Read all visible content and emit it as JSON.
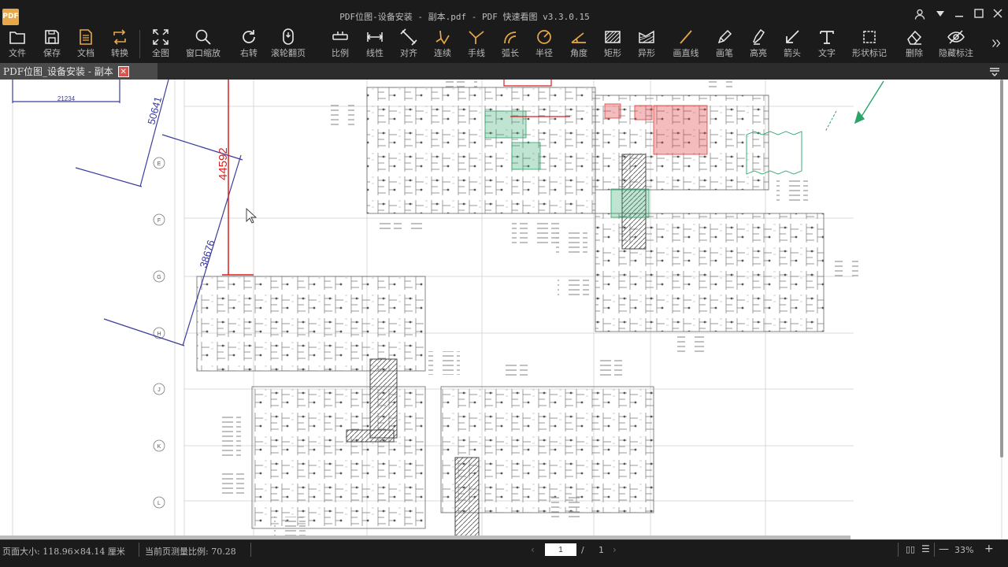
{
  "window": {
    "app_icon_text": "PDF",
    "title": "PDF位图-设备安装 - 副本.pdf - PDF 快速看图 v3.3.0.15"
  },
  "toolbar": [
    {
      "name": "file",
      "label": "文件"
    },
    {
      "name": "save",
      "label": "保存"
    },
    {
      "name": "document",
      "label": "文档"
    },
    {
      "name": "convert",
      "label": "转换"
    },
    {
      "name": "fit-all",
      "label": "全图"
    },
    {
      "name": "window-zoom",
      "label": "窗口缩放"
    },
    {
      "name": "rotate-right",
      "label": "右转"
    },
    {
      "name": "scroll-page",
      "label": "滚轮翻页"
    },
    {
      "name": "scale",
      "label": "比例"
    },
    {
      "name": "linear",
      "label": "线性"
    },
    {
      "name": "aligned",
      "label": "对齐"
    },
    {
      "name": "continuous",
      "label": "连续"
    },
    {
      "name": "hand-line",
      "label": "手线"
    },
    {
      "name": "arc-length",
      "label": "弧长"
    },
    {
      "name": "radius",
      "label": "半径"
    },
    {
      "name": "angle",
      "label": "角度"
    },
    {
      "name": "rectangle",
      "label": "矩形"
    },
    {
      "name": "irregular",
      "label": "异形"
    },
    {
      "name": "draw-line",
      "label": "画直线"
    },
    {
      "name": "pen",
      "label": "画笔"
    },
    {
      "name": "highlighter",
      "label": "高亮"
    },
    {
      "name": "arrow",
      "label": "箭头"
    },
    {
      "name": "text",
      "label": "文字"
    },
    {
      "name": "shape-mark",
      "label": "形状标记"
    },
    {
      "name": "delete",
      "label": "删除"
    },
    {
      "name": "hide-marks",
      "label": "隐藏标注"
    }
  ],
  "tab": {
    "title": "PDF位图_设备安装 - 副本",
    "close": "✕"
  },
  "drawing": {
    "dim_top": "21234",
    "dim_a": "50641",
    "dim_red": "44592",
    "dim_b": "38676",
    "grid_labels": [
      "E",
      "F",
      "G",
      "H",
      "J",
      "K",
      "L"
    ]
  },
  "status": {
    "page_size": "页面大小: 118.96×84.14 厘米",
    "ratio": "当前页测量比例: 70.28",
    "page_current": "1",
    "page_slash": "/",
    "page_total": "1",
    "zoom": "33%"
  },
  "colors": {
    "bg": "#1b1b1b",
    "label": "#b8b8b8",
    "icon": "#e8e8e8",
    "accent_orange": "#e8a84a",
    "dim_blue": "#3c3c9c",
    "dim_red": "#d82020",
    "mark_green": "#2aa56a"
  }
}
